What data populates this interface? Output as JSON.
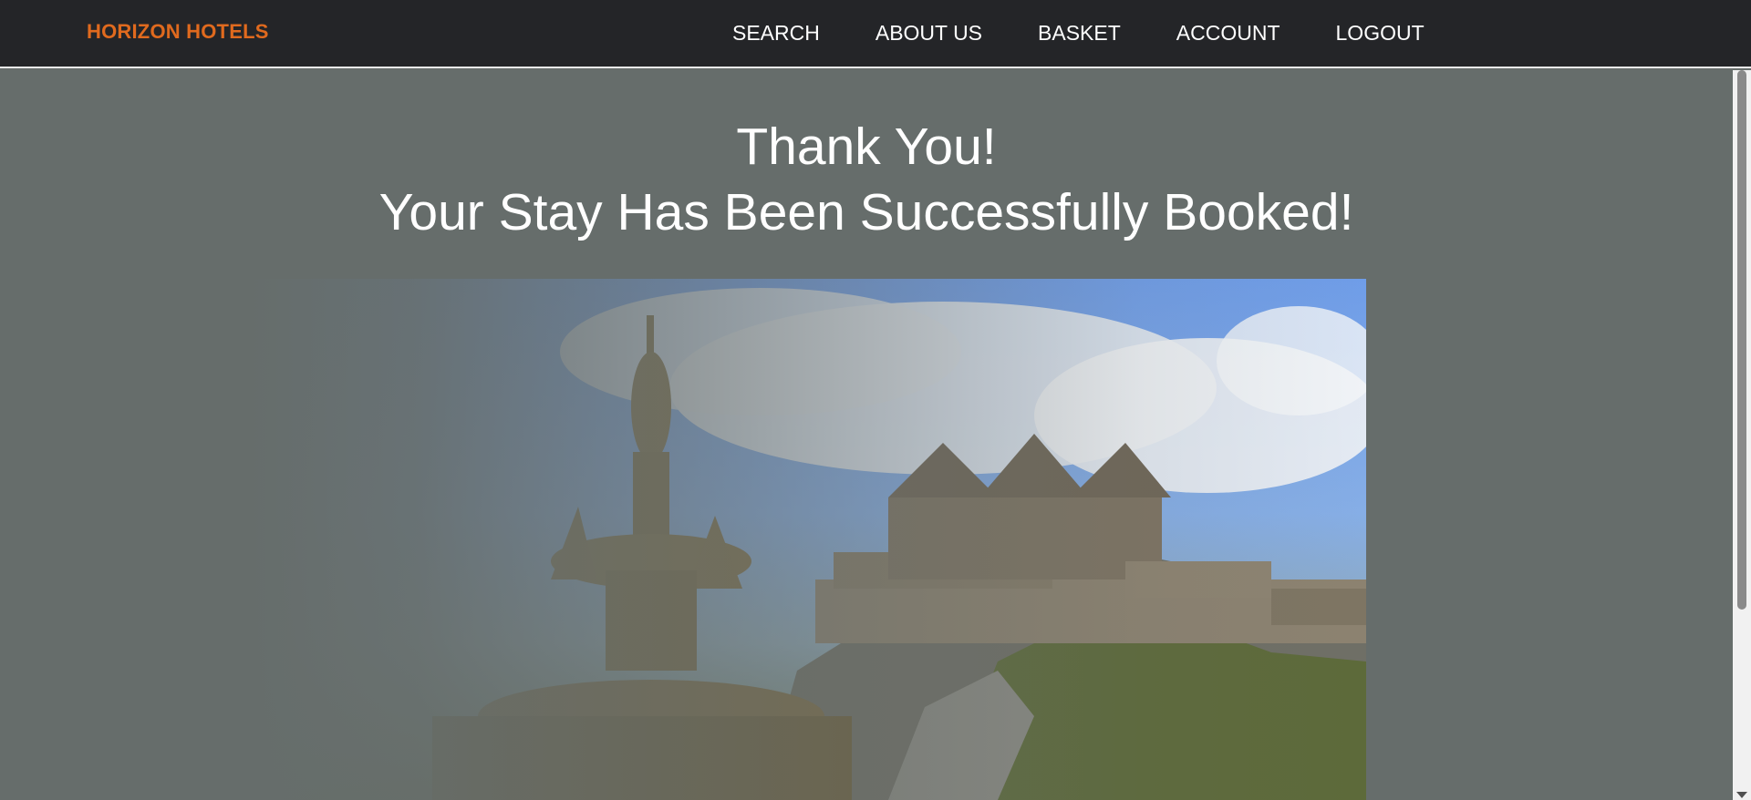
{
  "brand": "HORIZON HOTELS",
  "nav": {
    "search": "SEARCH",
    "about": "ABOUT US",
    "basket": "BASKET",
    "account": "ACCOUNT",
    "logout": "LOGOUT"
  },
  "hero": {
    "line1": "Thank You!",
    "line2": "Your Stay Has Been Successfully Booked!"
  },
  "colors": {
    "nav_background": "#242528",
    "brand_accent": "#e06a1e",
    "page_background": "#666d6b"
  }
}
